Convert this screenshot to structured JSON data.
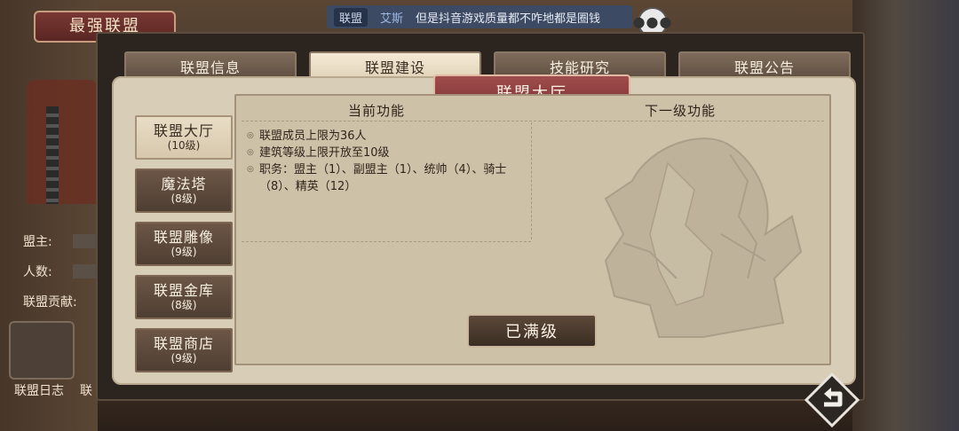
{
  "guild": {
    "name": "最强联盟"
  },
  "side": {
    "leader_label": "盟主:",
    "members_label": "人数:",
    "contribution_label": "联盟贡献:",
    "log_label": "联盟日志",
    "log_label2": "联"
  },
  "chat": {
    "channel": "联盟",
    "user": "艾斯",
    "message": "但是抖音游戏质量都不咋地都是圈钱",
    "more_icon": "ellipsis-icon"
  },
  "tabs": [
    {
      "label": "联盟信息",
      "active": false
    },
    {
      "label": "联盟建设",
      "active": true
    },
    {
      "label": "技能研究",
      "active": false
    },
    {
      "label": "联盟公告",
      "active": false
    }
  ],
  "panel": {
    "title": "联盟大厅",
    "current_header": "当前功能",
    "next_header": "下一级功能",
    "current_features": [
      "联盟成员上限为36人",
      "建筑等级上限开放至10级",
      "职务：盟主（1）、副盟主（1）、统帅（4）、骑士（8）、精英（12）"
    ],
    "max_button": "已满级"
  },
  "buildings": [
    {
      "name": "联盟大厅",
      "level": "(10级)",
      "active": true
    },
    {
      "name": "魔法塔",
      "level": "(8级)",
      "active": false
    },
    {
      "name": "联盟雕像",
      "level": "(9级)",
      "active": false
    },
    {
      "name": "联盟金库",
      "level": "(8级)",
      "active": false
    },
    {
      "name": "联盟商店",
      "level": "(9级)",
      "active": false
    }
  ],
  "colors": {
    "tab_active": "#f4ead5",
    "banner": "#a04d4c",
    "panel_bg": "#d8cdb6"
  }
}
